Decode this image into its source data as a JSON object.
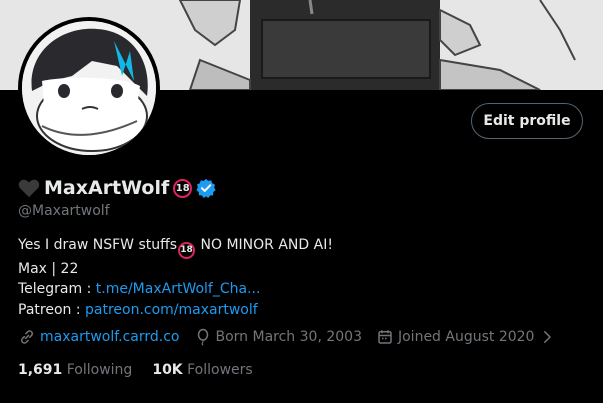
{
  "profile": {
    "display_name": "MaxArtWolf",
    "handle": "@Maxartwolf",
    "adult_badge": "18",
    "edit_profile_label": "Edit profile"
  },
  "bio": {
    "line1_text": "Yes I draw NSFW stuffs",
    "line1_suffix": " NO MINOR AND AI!",
    "line2": "Max | 22",
    "telegram_label": "Telegram : ",
    "telegram_link": "t.me/MaxArtWolf_Cha...",
    "patreon_label": "Patreon : ",
    "patreon_link": "patreon.com/maxartwolf"
  },
  "meta": {
    "website": "maxartwolf.carrd.co",
    "born": "Born March 30, 2003",
    "joined": "Joined August 2020"
  },
  "stats": {
    "following_count": "1,691",
    "following_label": "Following",
    "followers_count": "10K",
    "followers_label": "Followers"
  },
  "colors": {
    "background": "#000000",
    "accent_link": "#1d9bf0",
    "secondary_text": "#71767b",
    "primary_text": "#e7e9ea",
    "adult_badge_ring": "#e0245e"
  },
  "icons": [
    "black-heart-icon",
    "verified-badge-icon",
    "link-icon",
    "balloon-icon",
    "calendar-icon",
    "chevron-right-icon"
  ]
}
